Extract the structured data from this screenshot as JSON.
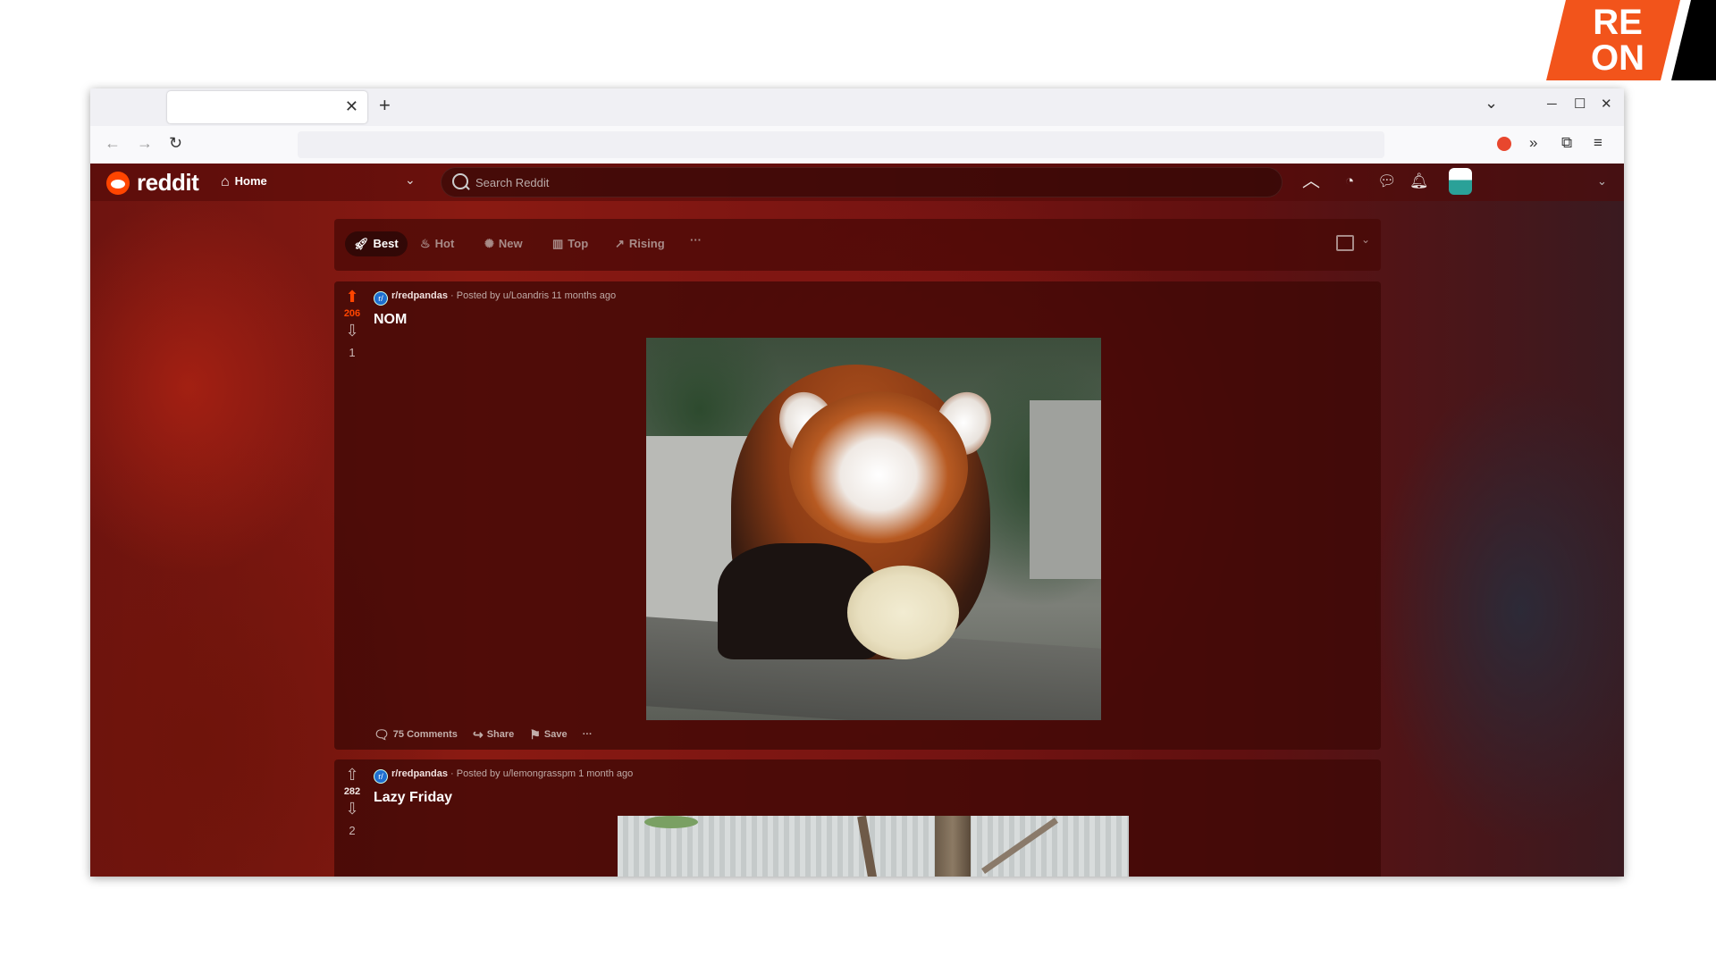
{
  "corner_logo": {
    "line1": "RE",
    "line2": "ON"
  },
  "browser": {
    "tab": {
      "title": "",
      "close": "✕"
    },
    "new_tab": "+",
    "controls": {
      "list": "⌄",
      "minimize": "─",
      "maximize": "☐",
      "close": "✕"
    },
    "nav": {
      "back": "←",
      "forward": "→",
      "reload": "↻"
    },
    "url": "",
    "tools": [
      "ublock-icon",
      "extensions-overflow-icon",
      "extensions-icon",
      "menu-icon"
    ]
  },
  "header": {
    "logo_text": "reddit",
    "home_label": "Home",
    "search_placeholder": "Search Reddit"
  },
  "sort": {
    "items": [
      {
        "label": "Best",
        "icon": "rocket-icon",
        "active": true
      },
      {
        "label": "Hot",
        "icon": "flame-icon"
      },
      {
        "label": "New",
        "icon": "sparkle-icon"
      },
      {
        "label": "Top",
        "icon": "chart-icon"
      },
      {
        "label": "Rising",
        "icon": "trend-icon"
      }
    ],
    "more": "···"
  },
  "posts": [
    {
      "subreddit": "r/redpandas",
      "meta": " · Posted by u/Loandris 11 months ago",
      "title": "NOM",
      "upvotes": "206",
      "downvotes": "1",
      "upvoted": true,
      "actions": {
        "comments": "75 Comments",
        "share": "Share",
        "save": "Save",
        "more": "···"
      }
    },
    {
      "subreddit": "r/redpandas",
      "meta": " · Posted by u/lemongrasspm 1 month ago",
      "title": "Lazy Friday",
      "upvotes": "282",
      "downvotes": "2",
      "upvoted": false
    }
  ],
  "colors": {
    "reddit_orange": "#ff4500",
    "brand_corner_orange": "#f2541b"
  }
}
